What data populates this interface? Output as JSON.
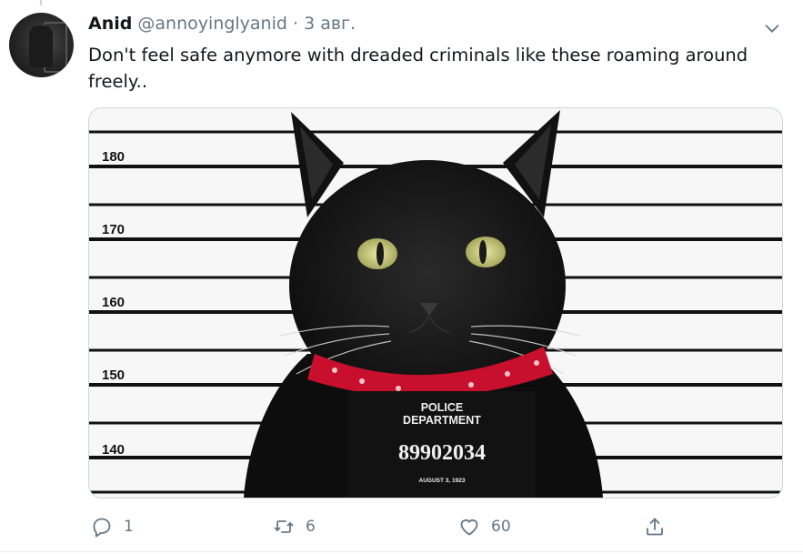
{
  "tweet": {
    "author_name": "Anid",
    "handle": "@annoyinglyanid",
    "separator": "·",
    "date": "3 авг.",
    "text": "Don't feel safe anymore with dreaded criminals like these roaming around freely..",
    "avatar_icon": "avatar-photo"
  },
  "media": {
    "height_marks": [
      "180",
      "170",
      "160",
      "150",
      "140"
    ],
    "placard_line1": "POLICE",
    "placard_line2": "DEPARTMENT",
    "placard_number": "89902034",
    "placard_date": "AUGUST 3, 1923",
    "collar_color": "#c8102e"
  },
  "actions": {
    "reply_count": "1",
    "retweet_count": "6",
    "like_count": "60",
    "icons": [
      "reply-icon",
      "retweet-icon",
      "like-icon",
      "share-icon"
    ]
  },
  "colors": {
    "text_primary": "#14171a",
    "text_secondary": "#657786",
    "border": "#ccd6dd"
  }
}
